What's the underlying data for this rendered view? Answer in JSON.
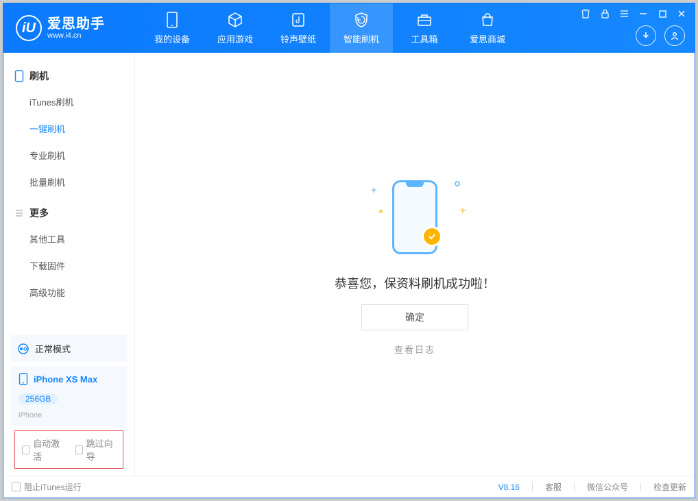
{
  "app": {
    "logo_initial": "iU",
    "name_cn": "爱思助手",
    "url": "www.i4.cn"
  },
  "main_tabs": [
    {
      "label": "我的设备",
      "icon": "device-icon"
    },
    {
      "label": "应用游戏",
      "icon": "cube-icon"
    },
    {
      "label": "铃声壁纸",
      "icon": "music-icon"
    },
    {
      "label": "智能刷机",
      "icon": "shield-icon",
      "active": true
    },
    {
      "label": "工具箱",
      "icon": "toolbox-icon"
    },
    {
      "label": "爱思商城",
      "icon": "shop-icon"
    }
  ],
  "sidebar": {
    "group1_title": "刷机",
    "group1_items": [
      {
        "label": "iTunes刷机"
      },
      {
        "label": "一键刷机",
        "active": true
      },
      {
        "label": "专业刷机"
      },
      {
        "label": "批量刷机"
      }
    ],
    "group2_title": "更多",
    "group2_items": [
      {
        "label": "其他工具"
      },
      {
        "label": "下载固件"
      },
      {
        "label": "高级功能"
      }
    ],
    "mode_label": "正常模式",
    "device_name": "iPhone XS Max",
    "device_storage": "256GB",
    "device_type": "iPhone",
    "cb1_label": "自动激活",
    "cb2_label": "跳过向导"
  },
  "main": {
    "success_text": "恭喜您，保资料刷机成功啦！",
    "confirm_btn": "确定",
    "log_link": "查看日志"
  },
  "footer": {
    "block_itunes": "阻止iTunes运行",
    "version": "V8.16",
    "link_support": "客服",
    "link_wechat": "微信公众号",
    "link_update": "检查更新"
  }
}
